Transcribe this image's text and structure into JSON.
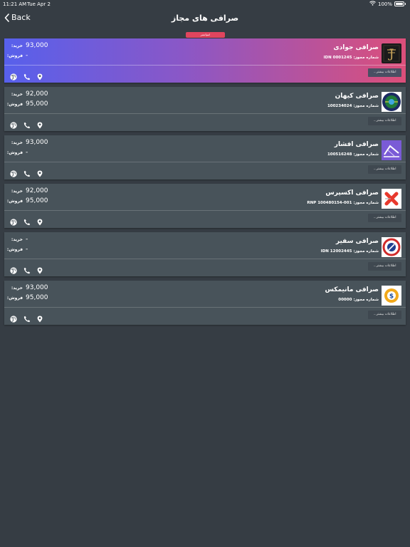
{
  "status_bar": {
    "time": "11:21 AM",
    "date": "Tue Apr 2",
    "battery": "100%"
  },
  "nav": {
    "back_label": "Back",
    "title": "صرافی های مجاز"
  },
  "ad_label": "اسپانسر",
  "labels": {
    "buy": "خرید:",
    "sell": "فروش:",
    "more": "اطلاعات بیشتر..."
  },
  "colors": {
    "background": "#363d44",
    "card": "#48535a",
    "featured_gradient": [
      "#5760ec",
      "#dc4f7a"
    ],
    "ad_pill": "#e0455e"
  },
  "exchanges": [
    {
      "name": "صرافی جوادی",
      "license": "شماره مجوز: IDN 0001245",
      "buy": "93,000",
      "sell": "-",
      "logo": "javadi-logo",
      "featured": true
    },
    {
      "name": "صرافی کیهان",
      "license": "شماره مجوز: 100234024",
      "buy": "92,000",
      "sell": "95,000",
      "logo": "keyhan-logo",
      "featured": false
    },
    {
      "name": "صرافی افشار",
      "license": "شماره مجوز: 100516248",
      "buy": "93,000",
      "sell": "-",
      "logo": "afshar-logo",
      "featured": false
    },
    {
      "name": "صرافی اکسپرس",
      "license": "شماره مجوز: RNP 100480154-001",
      "buy": "92,000",
      "sell": "95,000",
      "logo": "express-logo",
      "featured": false
    },
    {
      "name": "صرافی سفیر",
      "license": "شماره مجوز: IDN 12002445",
      "buy": "-",
      "sell": "-",
      "logo": "safir-logo",
      "featured": false
    },
    {
      "name": "صرافی مانیمکس",
      "license": "شماره مجوز: 00000",
      "buy": "93,000",
      "sell": "95,000",
      "logo": "moneymax-logo",
      "featured": false
    }
  ],
  "action_icons": [
    "globe-icon",
    "phone-icon",
    "location-pin-icon"
  ]
}
